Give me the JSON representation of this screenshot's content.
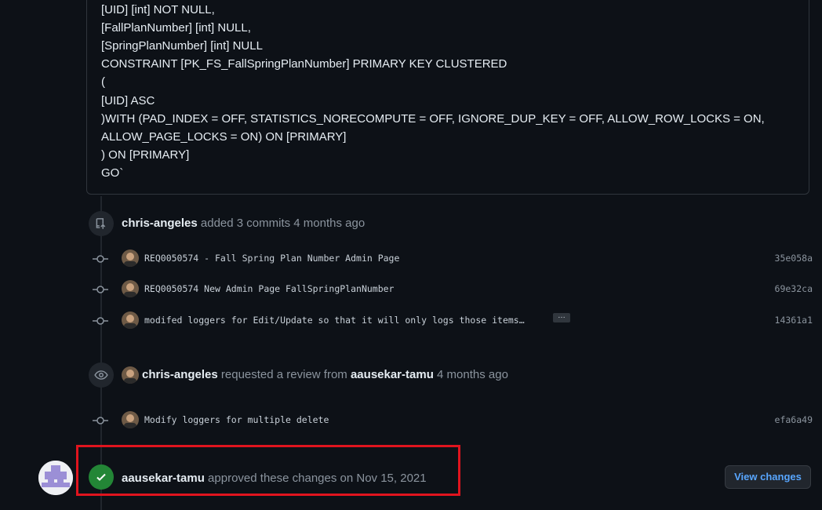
{
  "sql": {
    "lines": [
      "[UID] [int] NOT NULL,",
      "[FallPlanNumber] [int] NULL,",
      "[SpringPlanNumber] [int] NULL",
      "CONSTRAINT [PK_FS_FallSpringPlanNumber] PRIMARY KEY CLUSTERED",
      "(",
      "[UID] ASC",
      ")WITH (PAD_INDEX = OFF, STATISTICS_NORECOMPUTE = OFF, IGNORE_DUP_KEY = OFF, ALLOW_ROW_LOCKS = ON,",
      "ALLOW_PAGE_LOCKS = ON) ON [PRIMARY]",
      ") ON [PRIMARY]",
      "GO`"
    ]
  },
  "events": {
    "commits_event": {
      "user": "chris-angeles",
      "action": " added 3 commits 4 months ago"
    },
    "review_event": {
      "user": "chris-angeles",
      "action_1": " requested a review from ",
      "reviewer": "aausekar-tamu",
      "action_2": " 4 months ago"
    },
    "approve_event": {
      "user": "aausekar-tamu",
      "action": " approved these changes on Nov 15, 2021",
      "button": "View changes"
    }
  },
  "commits": [
    {
      "message": "REQ0050574 - Fall Spring Plan Number Admin Page",
      "sha": "35e058a"
    },
    {
      "message": "REQ0050574 New Admin Page FallSpringPlanNumber",
      "sha": "69e32ca"
    },
    {
      "message": "modifed loggers for Edit/Update so that it will only logs those items…",
      "sha": "14361a1",
      "ellipsis": "…"
    },
    {
      "message": "Modify loggers for multiple delete",
      "sha": "efa6a49"
    }
  ]
}
